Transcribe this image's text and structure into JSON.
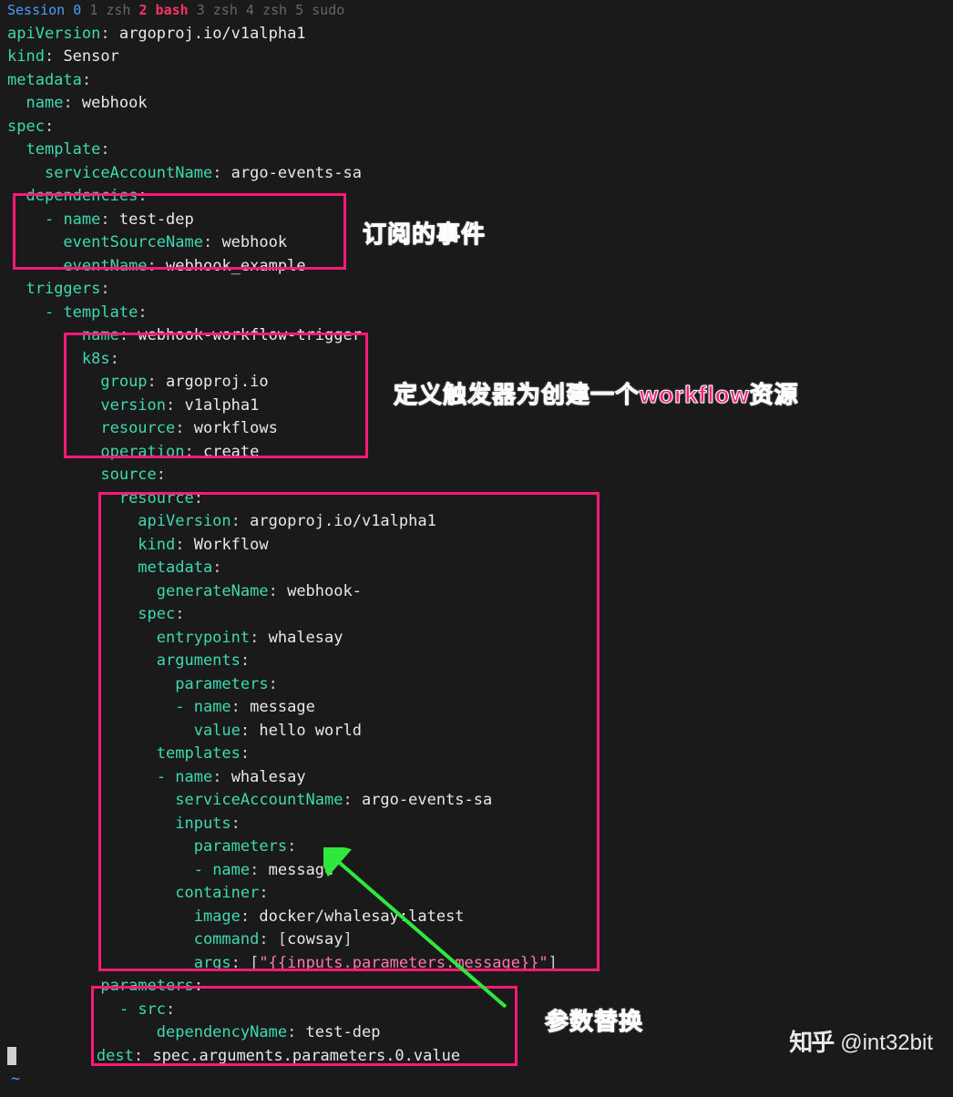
{
  "tabbar": {
    "session_label": "Session 0",
    "tabs": "1 zsh  ",
    "active_tab": "2 bash",
    "tabs_rest": "  3 zsh  4 zsh  5 sudo"
  },
  "yaml": {
    "l1_k": "apiVersion",
    "l1_v": "argoproj.io/v1alpha1",
    "l2_k": "kind",
    "l2_v": "Sensor",
    "l3_k": "metadata",
    "l4_k": "name",
    "l4_v": "webhook",
    "l5_k": "spec",
    "l6_k": "template",
    "l7_k": "serviceAccountName",
    "l7_v": "argo-events-sa",
    "l8_k": "dependencies",
    "l9_k": "name",
    "l9_v": "test-dep",
    "l10_k": "eventSourceName",
    "l10_v": "webhook",
    "l11_k": "eventName",
    "l11_v": "webhook_example",
    "l12_k": "triggers",
    "l13_k": "template",
    "l14_k": "name",
    "l14_v": "webhook-workflow-trigger",
    "l15_k": "k8s",
    "l16_k": "group",
    "l16_v": "argoproj.io",
    "l17_k": "version",
    "l17_v": "v1alpha1",
    "l18_k": "resource",
    "l18_v": "workflows",
    "l19_k": "operation",
    "l19_v": "create",
    "l20_k": "source",
    "l21_k": "resource",
    "l22_k": "apiVersion",
    "l22_v": "argoproj.io/v1alpha1",
    "l23_k": "kind",
    "l23_v": "Workflow",
    "l24_k": "metadata",
    "l25_k": "generateName",
    "l25_v": "webhook-",
    "l26_k": "spec",
    "l27_k": "entrypoint",
    "l27_v": "whalesay",
    "l28_k": "arguments",
    "l29_k": "parameters",
    "l30_k": "name",
    "l30_v": "message",
    "l31_k": "value",
    "l31_v": "hello world",
    "l32_k": "templates",
    "l33_k": "name",
    "l33_v": "whalesay",
    "l34_k": "serviceAccountName",
    "l34_v": "argo-events-sa",
    "l35_k": "inputs",
    "l36_k": "parameters",
    "l37_k": "name",
    "l37_v": "message",
    "l38_k": "container",
    "l39_k": "image",
    "l39_v": "docker/whalesay:latest",
    "l40_k": "command",
    "l40_v": "cowsay",
    "l41_k": "args",
    "l41_v": "\"{{inputs.parameters.message}}\"",
    "l42_k": "parameters",
    "l43_k": "src",
    "l44_k": "dependencyName",
    "l44_v": "test-dep",
    "l45_k": "dest",
    "l45_v": "spec.arguments.parameters.0.value",
    "tilde": "~"
  },
  "annotations": {
    "a1": "订阅的事件",
    "a2": "定义触发器为创建一个workflow资源",
    "a3": "参数替换"
  },
  "watermark": {
    "logo": "知乎",
    "handle": "@int32bit"
  }
}
